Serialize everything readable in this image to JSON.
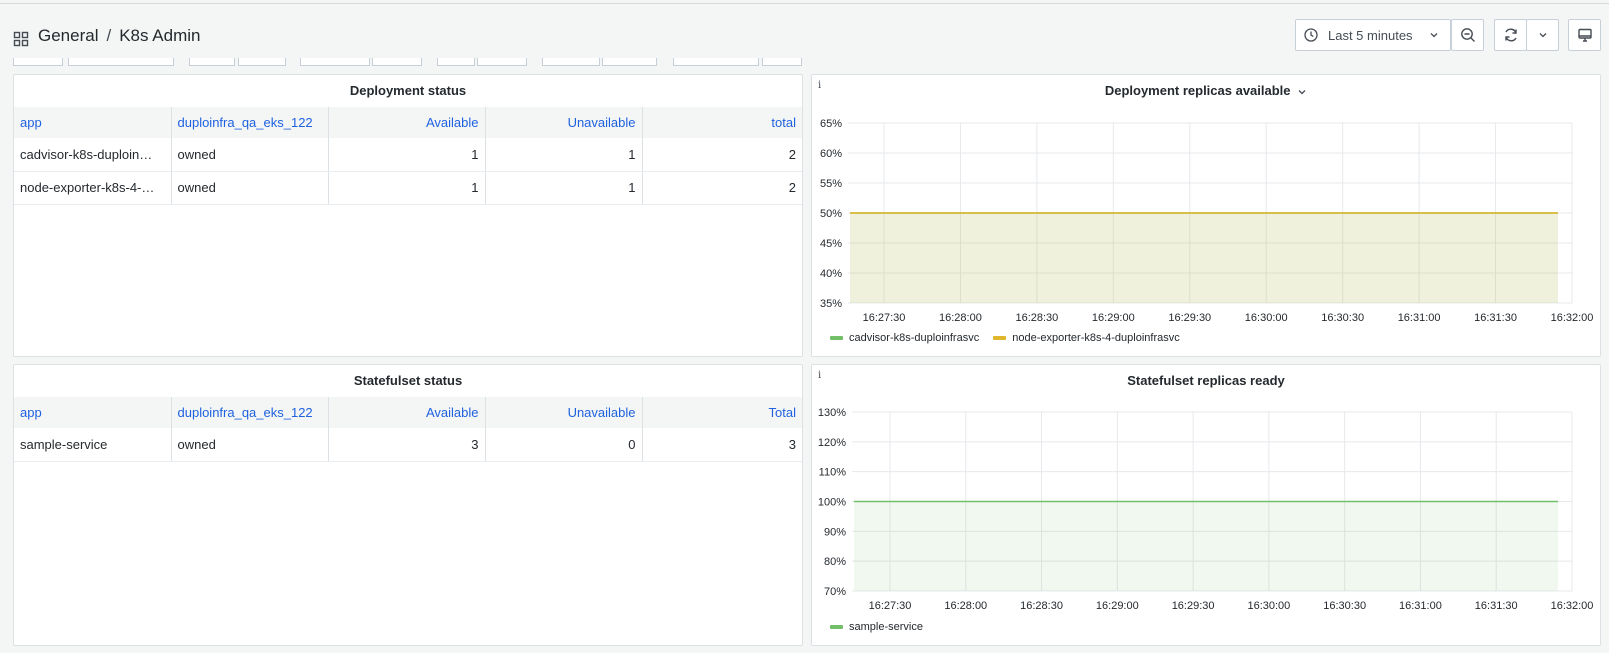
{
  "header": {
    "folder": "General",
    "separator": "/",
    "dashboard": "K8s Admin",
    "time_range": "Last 5 minutes"
  },
  "deployment_table": {
    "title": "Deployment status",
    "columns": [
      "app",
      "duploinfra_qa_eks_122",
      "Available",
      "Unavailable",
      "total"
    ],
    "rows": [
      [
        "cadvisor-k8s-duploin…",
        "owned",
        "1",
        "1",
        "2"
      ],
      [
        "node-exporter-k8s-4-…",
        "owned",
        "1",
        "1",
        "2"
      ]
    ]
  },
  "statefulset_table": {
    "title": "Statefulset status",
    "columns": [
      "app",
      "duploinfra_qa_eks_122",
      "Available",
      "Unavailable",
      "Total"
    ],
    "rows": [
      [
        "sample-service",
        "owned",
        "3",
        "0",
        "3"
      ]
    ]
  },
  "chart_data": [
    {
      "type": "area",
      "title": "Deployment replicas available",
      "x": [
        "16:27:30",
        "16:28:00",
        "16:28:30",
        "16:29:00",
        "16:29:30",
        "16:30:00",
        "16:30:30",
        "16:31:00",
        "16:31:30",
        "16:32:00"
      ],
      "yticks": [
        "65%",
        "60%",
        "55%",
        "50%",
        "45%",
        "40%",
        "35%"
      ],
      "ylim": [
        35,
        65
      ],
      "series": [
        {
          "name": "cadvisor-k8s-duploinfrasvc",
          "color": "#73bf69",
          "values": [
            50,
            50,
            50,
            50,
            50,
            50,
            50,
            50,
            50,
            50
          ]
        },
        {
          "name": "node-exporter-k8s-4-duploinfrasvc",
          "color": "#e0b62d",
          "values": [
            50,
            50,
            50,
            50,
            50,
            50,
            50,
            50,
            50,
            50
          ]
        }
      ],
      "grid": true,
      "legend": "bottom-left"
    },
    {
      "type": "area",
      "title": "Statefulset replicas ready",
      "x": [
        "16:27:30",
        "16:28:00",
        "16:28:30",
        "16:29:00",
        "16:29:30",
        "16:30:00",
        "16:30:30",
        "16:31:00",
        "16:31:30",
        "16:32:00"
      ],
      "yticks": [
        "130%",
        "120%",
        "110%",
        "100%",
        "90%",
        "80%",
        "70%"
      ],
      "ylim": [
        70,
        130
      ],
      "series": [
        {
          "name": "sample-service",
          "color": "#73bf69",
          "values": [
            100,
            100,
            100,
            100,
            100,
            100,
            100,
            100,
            100,
            100
          ]
        }
      ],
      "grid": true,
      "legend": "bottom-left"
    }
  ],
  "icons": {
    "breadcrumb": "dashboard-grid-icon",
    "time": "clock-icon",
    "zoom": "zoom-out-icon",
    "refresh": "refresh-icon",
    "refresh_menu": "chevron-down-icon",
    "tv": "tv-mode-icon",
    "panel_info": "info-icon",
    "panel_menu": "chevron-down-icon"
  }
}
